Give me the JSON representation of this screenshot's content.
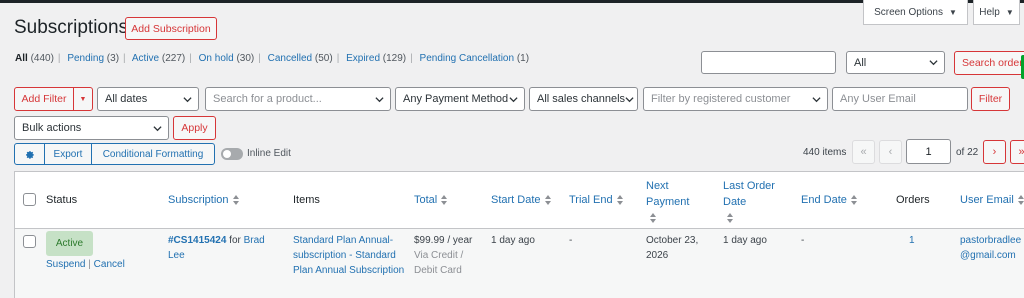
{
  "page": {
    "title": "Subscriptions",
    "add_button": "Add Subscription"
  },
  "top_tabs": {
    "screen_options": "Screen Options",
    "help": "Help"
  },
  "status_filters": [
    {
      "label": "All",
      "count": "(440)"
    },
    {
      "label": "Pending",
      "count": "(3)"
    },
    {
      "label": "Active",
      "count": "(227)"
    },
    {
      "label": "On hold",
      "count": "(30)"
    },
    {
      "label": "Cancelled",
      "count": "(50)"
    },
    {
      "label": "Expired",
      "count": "(129)"
    },
    {
      "label": "Pending Cancellation",
      "count": "(1)"
    }
  ],
  "search": {
    "value": "",
    "scope": "All",
    "button": "Search orders"
  },
  "filters": {
    "add_filter": "Add Filter",
    "dates": "All dates",
    "product_placeholder": "Search for a product...",
    "payment_method": "Any Payment Method",
    "sales_channels": "All sales channels",
    "customer_placeholder": "Filter by registered customer",
    "email_placeholder": "Any User Email",
    "filter_button": "Filter"
  },
  "bulk": {
    "actions": "Bulk actions",
    "apply": "Apply"
  },
  "toolbar": {
    "export": "Export",
    "conditional_formatting": "Conditional Formatting",
    "inline_edit": "Inline Edit"
  },
  "pagination": {
    "items": "440 items",
    "first": "«",
    "prev": "‹",
    "current_page": "1",
    "of": "of 22",
    "next": "›",
    "last": "»"
  },
  "columns": {
    "status": "Status",
    "subscription": "Subscription",
    "items": "Items",
    "total": "Total",
    "start_date": "Start Date",
    "trial_end": "Trial End",
    "next_payment": "Next Payment",
    "last_order_date": "Last Order Date",
    "end_date": "End Date",
    "orders": "Orders",
    "user_email": "User Email"
  },
  "row": {
    "status": "Active",
    "suspend": "Suspend",
    "cancel": "Cancel",
    "subscription_id": "#CS1415424",
    "for_text": "for",
    "customer": "Brad Lee",
    "items": "Standard Plan Annual-subscription - Standard Plan Annual Subscription",
    "total": "$99.99 / year",
    "payment_via": "Via Credit / Debit Card",
    "start_date": "1 day ago",
    "trial_end": "-",
    "next_payment": "October 23, 2026",
    "last_order_date": "1 day ago",
    "end_date": "-",
    "orders": "1",
    "user_email": "pastorbradlee@gmail.com"
  },
  "colors": {
    "accent": "#2271b1",
    "action_red": "#d63638",
    "active_badge_bg": "#c6e1c6",
    "active_badge_text": "#2c7a2c"
  }
}
